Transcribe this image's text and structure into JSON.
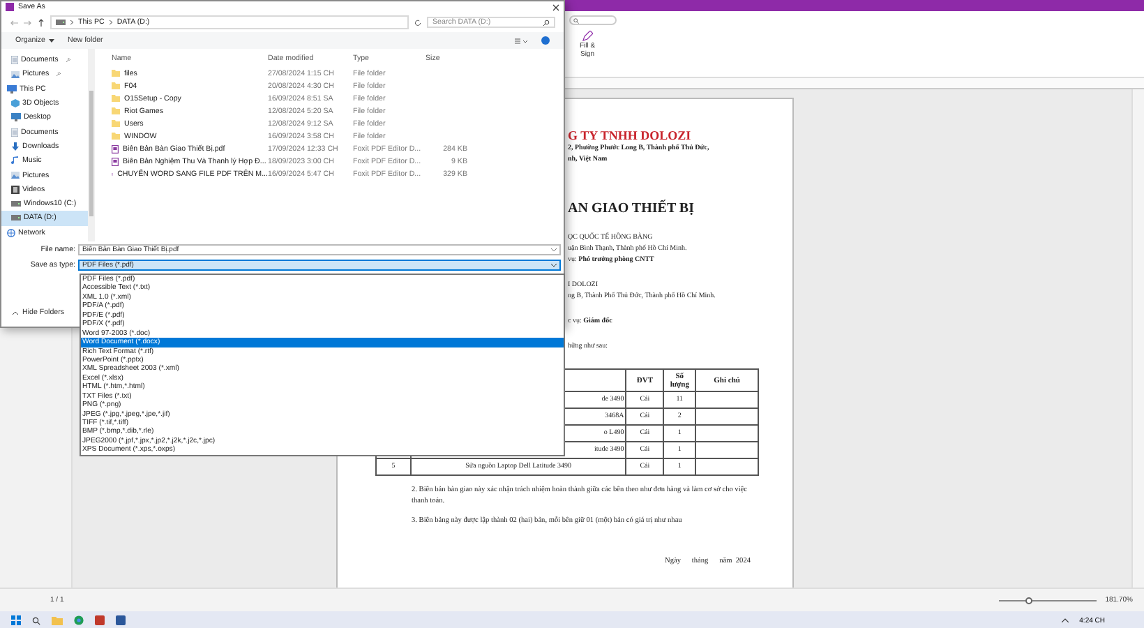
{
  "ribbon": {
    "fill_sign": "Fill & Sign"
  },
  "document": {
    "lines": [
      {
        "kind": "company",
        "text": "G TY TNHH DOLOZI"
      },
      {
        "kind": "line",
        "text": "**2, Phường Phước Long B, Thành phố Thủ Đức,**"
      },
      {
        "kind": "line",
        "text": "**nh, Việt Nam**"
      },
      {
        "kind": "title",
        "text": "AN GIAO THIẾT BỊ"
      },
      {
        "kind": "section",
        "text": "ỌC QUỐC TẾ HỒNG BÀNG"
      },
      {
        "kind": "line",
        "text": "uận Bình Thạnh, Thành phố Hồ Chí Minh."
      },
      {
        "kind": "line",
        "text": "vụ: **Phó trưởng phòng CNTT**"
      },
      {
        "kind": "section",
        "text": "I DOLOZI"
      },
      {
        "kind": "line",
        "text": "ng B, Thành Phố Thủ Đức, Thành phố Hồ Chí Minh."
      },
      {
        "kind": "section",
        "text": "c vụ: **Giám đốc**"
      },
      {
        "kind": "section",
        "text": "hững như sau:"
      }
    ],
    "table": {
      "columns": [
        "",
        "",
        "ĐVT",
        "Số lượng",
        "Ghi chú"
      ],
      "rows": [
        {
          "cells": [
            "",
            "de 3490",
            "Cái",
            "11",
            ""
          ]
        },
        {
          "cells": [
            "",
            "3468A",
            "Cái",
            "2",
            ""
          ]
        },
        {
          "cells": [
            "",
            "o L490",
            "Cái",
            "1",
            ""
          ]
        },
        {
          "cells": [
            "",
            "itude 3490",
            "Cái",
            "1",
            ""
          ]
        },
        {
          "cells": [
            "5",
            "Sửa nguồn Laptop Dell Latitude 3490",
            "Cái",
            "1",
            ""
          ]
        }
      ]
    },
    "paragraphs": [
      "2. Biên bản bàn giao này xác nhận trách nhiệm hoàn thành giữa các bên theo như đơn hàng và làm cơ sở cho việc thanh toán.",
      "3. Biên bảng này được lập thành 02 (hai) bản, mỗi bên giữ 01 (một) bản có giá trị như nhau"
    ],
    "date_line": "Ngày      tháng      năm  2024"
  },
  "status_bar": {
    "page": "1 / 1",
    "zoom": "181.70%",
    "zoom_slider": {
      "level": 0.3
    }
  },
  "taskbar": {
    "time": "4:24 CH"
  },
  "dialog": {
    "title": "Save As",
    "path": [
      "This PC",
      "DATA (D:)"
    ],
    "search_placeholder": "Search DATA (D:)",
    "commands": [
      {
        "label": "Organize",
        "menu": true
      },
      {
        "label": "New folder",
        "menu": false
      }
    ],
    "nav": [
      {
        "label": "Documents",
        "kind": "documents",
        "pinned": true,
        "selected": false
      },
      {
        "label": "Pictures",
        "kind": "pictures",
        "pinned": true,
        "selected": false
      },
      {
        "label": "This PC",
        "kind": "pc",
        "pinned": false,
        "selected": false,
        "children": [
          {
            "label": "3D Objects",
            "kind": "cube",
            "pinned": false,
            "selected": false
          },
          {
            "label": "Desktop",
            "kind": "desktop",
            "pinned": false,
            "selected": false
          },
          {
            "label": "Documents",
            "kind": "documents",
            "pinned": false,
            "selected": false
          },
          {
            "label": "Downloads",
            "kind": "download",
            "pinned": false,
            "selected": false
          },
          {
            "label": "Music",
            "kind": "music",
            "pinned": false,
            "selected": false
          },
          {
            "label": "Pictures",
            "kind": "pictures",
            "pinned": false,
            "selected": false
          },
          {
            "label": "Videos",
            "kind": "videos",
            "pinned": false,
            "selected": false
          },
          {
            "label": "Windows10 (C:)",
            "kind": "drive",
            "pinned": false,
            "selected": false
          },
          {
            "label": "DATA (D:)",
            "kind": "drive",
            "pinned": false,
            "selected": true
          }
        ]
      },
      {
        "label": "Network",
        "kind": "network",
        "pinned": false,
        "selected": false
      }
    ],
    "columns": [
      "Name",
      "Date modified",
      "Type",
      "Size"
    ],
    "files": [
      {
        "kind": "folder",
        "name": "files",
        "date": "27/08/2024 1:15 CH",
        "type": "File folder"
      },
      {
        "kind": "folder",
        "name": "F04",
        "date": "20/08/2024 4:30 CH",
        "type": "File folder"
      },
      {
        "kind": "folder",
        "name": "O15Setup - Copy",
        "date": "16/09/2024 8:51 SA",
        "type": "File folder"
      },
      {
        "kind": "folder",
        "name": "Riot Games",
        "date": "12/08/2024 5:20 SA",
        "type": "File folder"
      },
      {
        "kind": "folder",
        "name": "Users",
        "date": "12/08/2024 9:12 SA",
        "type": "File folder"
      },
      {
        "kind": "folder",
        "name": "WINDOW",
        "date": "16/09/2024 3:58 CH",
        "type": "File folder"
      },
      {
        "kind": "pdf",
        "name": "Biên Bản Bàn Giao Thiết Bị.pdf",
        "date": "17/09/2024 12:33 CH",
        "type": "Foxit PDF Editor D...",
        "size": "284 KB"
      },
      {
        "kind": "pdf",
        "name": "Biên Bản Nghiệm Thu Và Thanh lý Hợp Đ...",
        "date": "18/09/2023 3:00 CH",
        "type": "Foxit PDF Editor D...",
        "size": "9 KB"
      },
      {
        "kind": "pdf",
        "name": "CHUYỂN WORD SANG FILE PDF TRÊN M...",
        "date": "16/09/2024 5:47 CH",
        "type": "Foxit PDF Editor D...",
        "size": "329 KB"
      }
    ],
    "file_name_label": "File name:",
    "file_name": "Biên Bản Bàn Giao Thiết Bị.pdf",
    "save_type_label": "Save as type:",
    "save_type": "PDF Files (*.pdf)",
    "hide_folders": "Hide Folders",
    "type_options": [
      {
        "label": "PDF Files (*.pdf)",
        "selected": false
      },
      {
        "label": "Accessible Text (*.txt)",
        "selected": false
      },
      {
        "label": "XML 1.0 (*.xml)",
        "selected": false
      },
      {
        "label": "PDF/A (*.pdf)",
        "selected": false
      },
      {
        "label": "PDF/E (*.pdf)",
        "selected": false
      },
      {
        "label": "PDF/X (*.pdf)",
        "selected": false
      },
      {
        "label": "Word 97-2003 (*.doc)",
        "selected": false
      },
      {
        "label": "Word Document (*.docx)",
        "selected": true
      },
      {
        "label": "Rich Text Format (*.rtf)",
        "selected": false
      },
      {
        "label": "PowerPoint (*.pptx)",
        "selected": false
      },
      {
        "label": "XML Spreadsheet 2003 (*.xml)",
        "selected": false
      },
      {
        "label": "Excel (*.xlsx)",
        "selected": false
      },
      {
        "label": "HTML (*.htm,*.html)",
        "selected": false
      },
      {
        "label": "TXT Files (*.txt)",
        "selected": false
      },
      {
        "label": "PNG (*.png)",
        "selected": false
      },
      {
        "label": "JPEG (*.jpg,*.jpeg,*.jpe,*.jif)",
        "selected": false
      },
      {
        "label": "TIFF (*.tif,*.tiff)",
        "selected": false
      },
      {
        "label": "BMP (*.bmp,*.dib,*.rle)",
        "selected": false
      },
      {
        "label": "JPEG2000 (*.jpf,*.jpx,*.jp2,*.j2k,*.j2c,*.jpc)",
        "selected": false
      },
      {
        "label": "XPS Document (*.xps,*.oxps)",
        "selected": false
      }
    ]
  }
}
